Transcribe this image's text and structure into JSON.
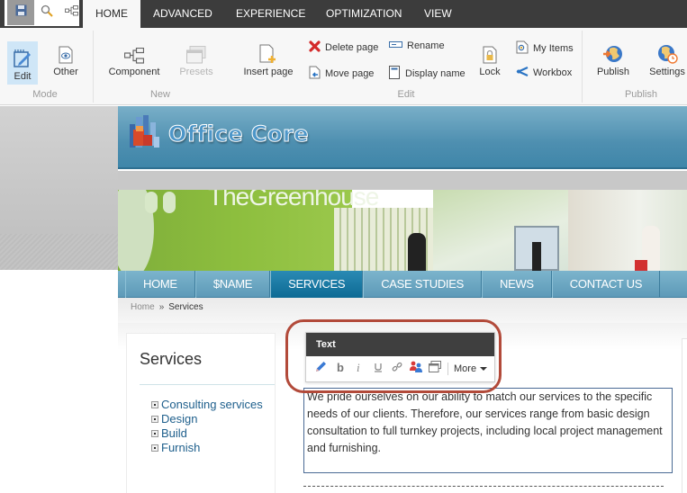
{
  "quick_access": [
    {
      "name": "save",
      "icon": "save-icon"
    },
    {
      "name": "search",
      "icon": "search-icon"
    },
    {
      "name": "navigation-tree",
      "icon": "tree-icon"
    }
  ],
  "tabs": [
    {
      "label": "HOME",
      "active": true
    },
    {
      "label": "ADVANCED",
      "active": false
    },
    {
      "label": "EXPERIENCE",
      "active": false
    },
    {
      "label": "OPTIMIZATION",
      "active": false
    },
    {
      "label": "VIEW",
      "active": false
    }
  ],
  "ribbon": {
    "groups": {
      "mode": "Mode",
      "new": "New",
      "edit": "Edit",
      "publish": "Publish"
    },
    "mode": {
      "edit": "Edit",
      "other": "Other"
    },
    "new": {
      "component": "Component",
      "presets": "Presets"
    },
    "edit": {
      "insert_page": "Insert page",
      "delete_page": "Delete page",
      "move_page": "Move page",
      "rename": "Rename",
      "display_name": "Display name",
      "lock": "Lock",
      "my_items": "My Items",
      "workbox": "Workbox"
    },
    "publish": {
      "publish": "Publish",
      "settings": "Settings"
    }
  },
  "site": {
    "logo_text": "Office Core",
    "banner_text": "TheGreenhouse",
    "nav": [
      {
        "label": "HOME",
        "active": false
      },
      {
        "label": "$NAME",
        "active": false
      },
      {
        "label": "SERVICES",
        "active": true
      },
      {
        "label": "CASE STUDIES",
        "active": false
      },
      {
        "label": "NEWS",
        "active": false
      },
      {
        "label": "CONTACT US",
        "active": false
      }
    ],
    "breadcrumb": {
      "home": "Home",
      "separator": "»",
      "current": "Services"
    },
    "sidebar": {
      "title": "Services",
      "items": [
        "Consulting services",
        "Design",
        "Build",
        "Furnish"
      ]
    },
    "body_text": "We pride ourselves on our ability to match our services to the specific needs of our clients. Therefore, our services range from basic design consultation to full turnkey projects, including local project management and furnishing."
  },
  "text_toolbar": {
    "title": "Text",
    "tools": [
      {
        "name": "edit",
        "icon": "pencil-icon"
      },
      {
        "name": "bold",
        "icon": "bold-icon"
      },
      {
        "name": "italic",
        "icon": "italic-icon"
      },
      {
        "name": "underline",
        "icon": "underline-icon"
      },
      {
        "name": "link",
        "icon": "link-icon"
      },
      {
        "name": "personalize",
        "icon": "users-icon"
      },
      {
        "name": "insert-window",
        "icon": "window-icon"
      }
    ],
    "more_label": "More"
  },
  "colors": {
    "tab_bar": "#3c3c3c",
    "highlight_ring": "#b24a3a",
    "nav_active": "#0d6a94",
    "link": "#1e5f8c"
  }
}
